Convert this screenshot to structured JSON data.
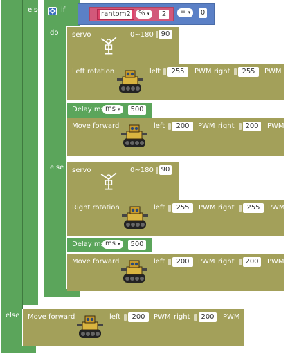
{
  "labels": {
    "else": "else",
    "if": "if",
    "do": "do",
    "servo": "servo",
    "servo_range": "0~180",
    "left_rotation": "Left rotation",
    "right_rotation": "Right rotation",
    "left": "left",
    "right": "right",
    "pwm": "PWM",
    "delay_ms": "Delay ms",
    "move_forward": "Move forward"
  },
  "condition": {
    "variable": "rantom2",
    "op": "%",
    "divisor": "2",
    "compare": "=",
    "value": "0"
  },
  "do_branch": {
    "servo_angle": "90",
    "rotate_left_pwm": "255",
    "rotate_right_pwm": "255",
    "delay_unit": "ms",
    "delay_value": "500",
    "forward_left_pwm": "200",
    "forward_right_pwm": "200"
  },
  "else_branch": {
    "servo_angle": "90",
    "rotate_left_pwm": "255",
    "rotate_right_pwm": "255",
    "delay_unit": "ms",
    "delay_value": "500",
    "forward_left_pwm": "200",
    "forward_right_pwm": "200"
  },
  "outer_else": {
    "forward_left_pwm": "200",
    "forward_right_pwm": "200"
  },
  "icons": [
    "gear-icon",
    "dropdown-arrow-icon",
    "servo-icon",
    "robot-tank-icon"
  ],
  "colors": {
    "logic_green": "#5ba55b",
    "motor_olive": "#a3a05a",
    "control_blue": "#5b80c6",
    "math_pink": "#d2587a",
    "variable_red": "#e0436a"
  }
}
